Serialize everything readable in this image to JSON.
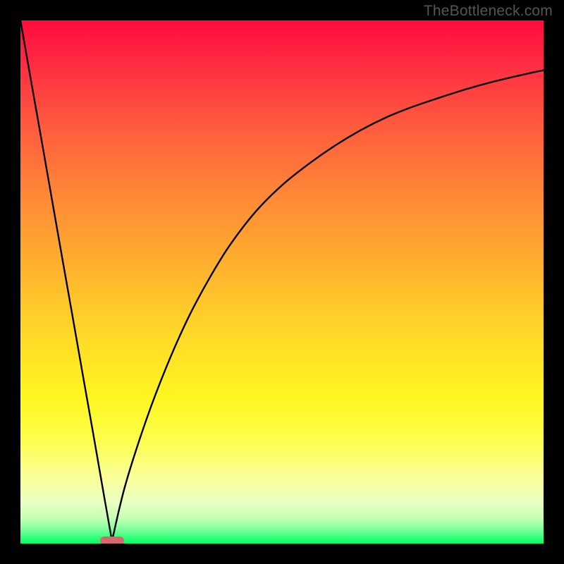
{
  "watermark": {
    "text": "TheBottleneck.com"
  },
  "chart_data": {
    "type": "line",
    "title": "",
    "xlabel": "",
    "ylabel": "",
    "xlim": [
      0,
      100
    ],
    "ylim": [
      0,
      100
    ],
    "grid": false,
    "legend": false,
    "background": "red-yellow-green vertical gradient",
    "notes": "Black V-shaped bottleneck curve on gradient background with cusp marker near bottom; axes are black borders with no ticks or labels.",
    "cusp": {
      "x": 17.5,
      "y": 99.5
    },
    "series": [
      {
        "name": "left-branch",
        "x": [
          0,
          2,
          4,
          6,
          8,
          10,
          12,
          14,
          16,
          17.5
        ],
        "values": [
          0,
          11.4,
          22.7,
          34.1,
          45.5,
          56.8,
          68.2,
          79.5,
          91,
          99.5
        ]
      },
      {
        "name": "right-branch",
        "x": [
          17.5,
          20,
          24,
          28,
          32,
          36,
          40,
          45,
          50,
          55,
          60,
          65,
          70,
          75,
          80,
          85,
          90,
          95,
          100
        ],
        "values": [
          99.5,
          89,
          76.5,
          66,
          57,
          49.5,
          43,
          36.5,
          31.5,
          27.5,
          24,
          21,
          18.5,
          16.5,
          14.8,
          13.2,
          11.8,
          10.6,
          9.5
        ]
      }
    ]
  }
}
